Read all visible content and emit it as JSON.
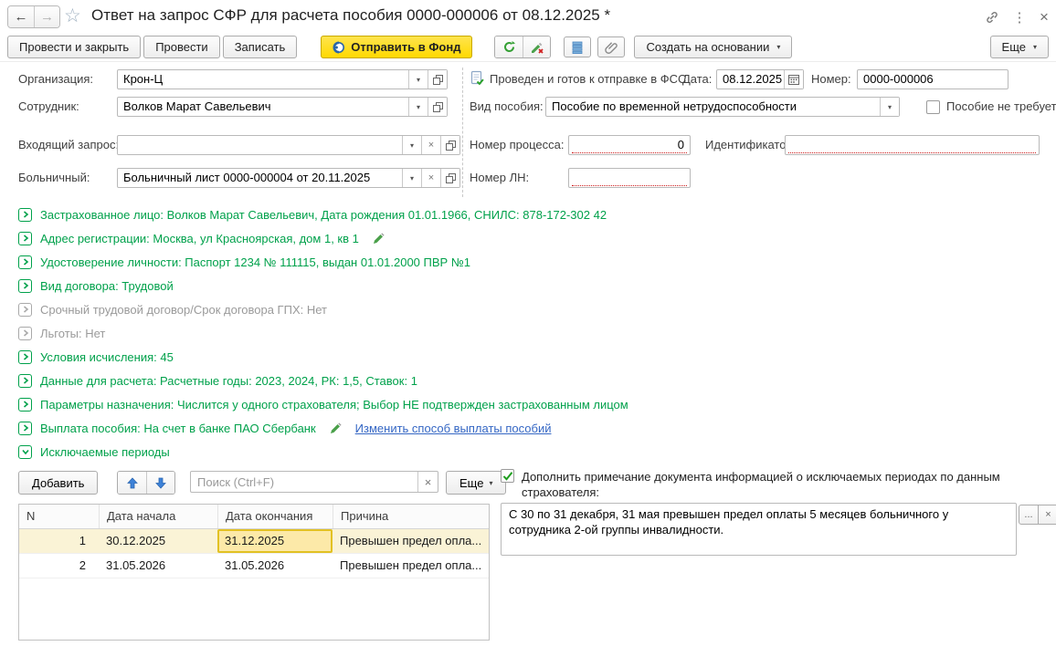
{
  "window": {
    "title": "Ответ на запрос СФР для расчета пособия 0000-000006 от 08.12.2025 *"
  },
  "icons": {
    "back": "←",
    "forward": "→",
    "star": "☆",
    "kebab": "⋮",
    "close": "×",
    "dropdown": "▾",
    "clear": "×",
    "ellipsis": "..."
  },
  "toolbar": {
    "post_and_close": "Провести и закрыть",
    "post": "Провести",
    "write": "Записать",
    "send_to_fund": "Отправить в Фонд",
    "create_based_on": "Создать на основании",
    "more": "Еще"
  },
  "fields": {
    "org_label": "Организация:",
    "org_value": "Крон-Ц",
    "status_text": "Проведен и готов к отправке в ФСС",
    "date_label": "Дата:",
    "date_value": "08.12.2025",
    "number_label": "Номер:",
    "number_value": "0000-000006",
    "employee_label": "Сотрудник:",
    "employee_value": "Волков Марат Савельевич",
    "benefit_type_label": "Вид пособия:",
    "benefit_type_value": "Пособие по временной нетрудоспособности",
    "benefit_not_required_label": "Пособие не требуется",
    "incoming_request_label": "Входящий запрос:",
    "incoming_request_value": "",
    "process_number_label": "Номер процесса:",
    "process_number_value": "0",
    "identifier_label": "Идентификатор:",
    "identifier_value": "",
    "sick_leave_label": "Больничный:",
    "sick_leave_value": "Больничный лист 0000-000004 от 20.11.2025",
    "ln_number_label": "Номер ЛН:",
    "ln_number_value": ""
  },
  "sections": [
    {
      "text": "Застрахованное лицо: Волков Марат Савельевич, Дата рождения 01.01.1966, СНИЛС: 878-172-302 42"
    },
    {
      "text": "Адрес регистрации: Москва, ул Красноярская, дом 1, кв 1"
    },
    {
      "text": "Удостоверение личности: Паспорт 1234 № 111115, выдан 01.01.2000 ПВР №1"
    },
    {
      "text": "Вид договора: Трудовой"
    },
    {
      "text": "Срочный трудовой договор/Срок договора ГПХ: Нет"
    },
    {
      "text": "Льготы: Нет"
    },
    {
      "text": "Условия исчисления: 45"
    },
    {
      "text": "Данные для расчета: Расчетные годы: 2023, 2024, РК: 1,5, Ставок: 1"
    },
    {
      "text": "Параметры назначения: Числится у одного страхователя; Выбор НЕ подтвержден застрахованным лицом"
    },
    {
      "text": "Выплата пособия: На счет в банке ПАО Сбербанк",
      "link": "Изменить способ выплаты пособий"
    },
    {
      "text": "Исключаемые периоды"
    }
  ],
  "periods": {
    "add_button": "Добавить",
    "search_placeholder": "Поиск (Ctrl+F)",
    "more_button": "Еще",
    "table": {
      "columns": [
        "N",
        "Дата начала",
        "Дата окончания",
        "Причина"
      ],
      "rows": [
        {
          "n": "1",
          "start": "30.12.2025",
          "end": "31.12.2025",
          "reason": "Превышен предел опла..."
        },
        {
          "n": "2",
          "start": "31.05.2026",
          "end": "31.05.2026",
          "reason": "Превышен предел опла..."
        }
      ]
    },
    "note_checkbox_label": "Дополнить примечание документа информацией о исключаемых периодах по данным страхователя:",
    "note_text": "С 30 по 31 декабря, 31 мая превышен предел оплаты 5 месяцев больничного у сотрудника 2-ой группы инвалидности."
  },
  "colors": {
    "section_green": "#00a14b",
    "link_blue": "#3567c4",
    "accent_yellow": "#ffd900",
    "selected_row": "#faf3d6",
    "active_cell": "#fce9a8"
  }
}
